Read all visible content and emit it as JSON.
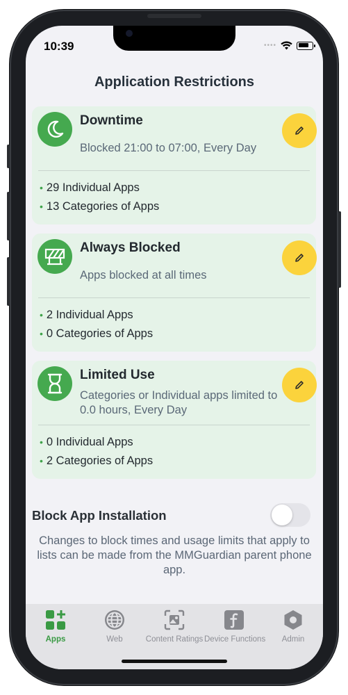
{
  "status_bar": {
    "time": "10:39",
    "signal_dots": "••••"
  },
  "page_title": "Application Restrictions",
  "cards": [
    {
      "title": "Downtime",
      "subtitle": "Blocked 21:00 to 07:00, Every Day",
      "bullets": [
        "29 Individual Apps",
        "13 Categories of Apps"
      ],
      "icon": "moon-icon"
    },
    {
      "title": "Always Blocked",
      "subtitle": "Apps blocked at all times",
      "bullets": [
        "2 Individual Apps",
        "0 Categories of Apps"
      ],
      "icon": "barrier-icon"
    },
    {
      "title": "Limited Use",
      "subtitle": "Categories or Individual apps limited to 0.0 hours, Every Day",
      "bullets": [
        "0 Individual Apps",
        "2 Categories of Apps"
      ],
      "icon": "hourglass-icon"
    }
  ],
  "block_install": {
    "label": "Block App Installation",
    "enabled": false,
    "note": "Changes to block times and usage limits that apply to lists can be made from the MMGuardian parent phone app."
  },
  "tabs": [
    {
      "label": "Apps",
      "icon": "apps-icon",
      "active": true
    },
    {
      "label": "Web",
      "icon": "globe-icon",
      "active": false
    },
    {
      "label": "Content Ratings",
      "icon": "content-ratings-icon",
      "active": false
    },
    {
      "label": "Device Functions",
      "icon": "device-functions-icon",
      "active": false
    },
    {
      "label": "Admin",
      "icon": "admin-hexagon-icon",
      "active": false
    }
  ],
  "colors": {
    "accent_green": "#45a94f",
    "card_background": "#e5f3e8",
    "edit_yellow": "#fbd33c",
    "screen_background": "#f2f2f6"
  }
}
